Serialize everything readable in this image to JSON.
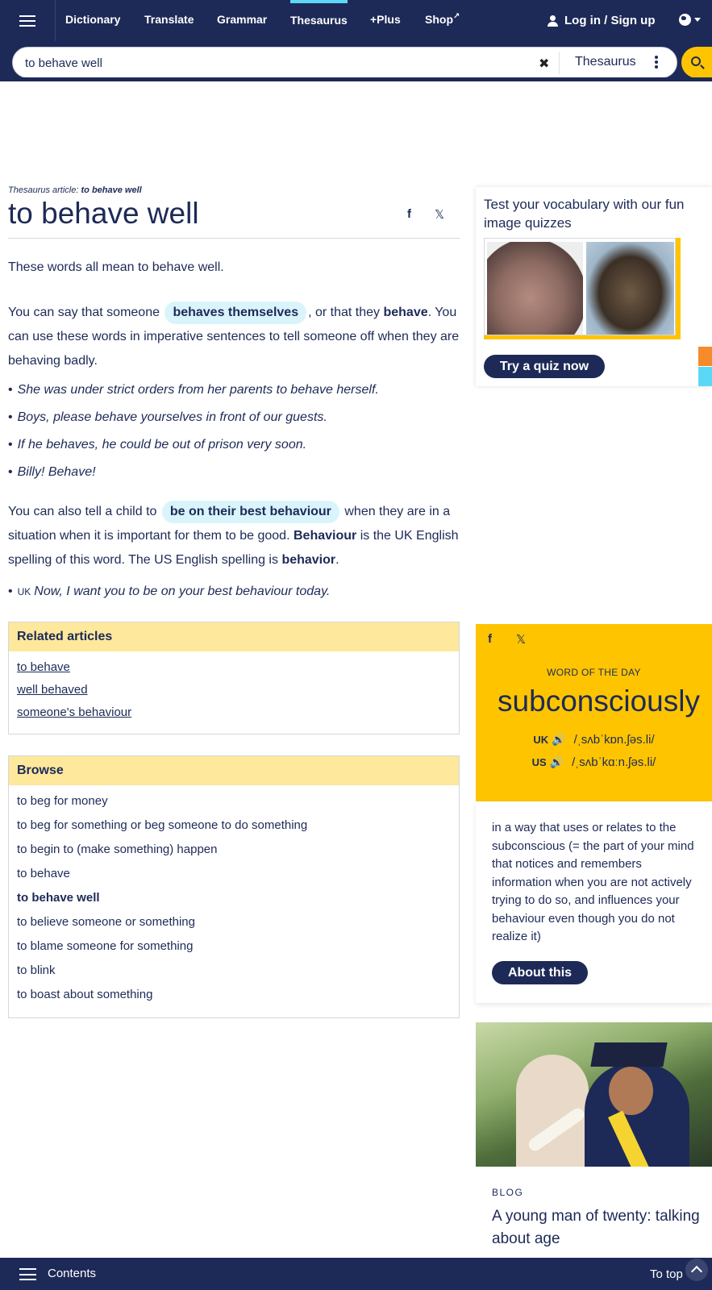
{
  "nav": {
    "items": [
      "Dictionary",
      "Translate",
      "Grammar",
      "Thesaurus",
      "+Plus",
      "Shop"
    ],
    "active": "Thesaurus",
    "login_label": "Log in / Sign up"
  },
  "search": {
    "value": "to behave well",
    "dictionary": "Thesaurus"
  },
  "article": {
    "crumb_prefix": "Thesaurus article:",
    "crumb_title": "to behave well",
    "headword": "to behave well",
    "intro": "These words all mean to behave well.",
    "para1": {
      "t1": "You can say that someone",
      "pill": "behaves themselves",
      "t2": ", or that they",
      "bold": "behave",
      "t3": ". You can use these words in imperative sentences to tell someone off when they are behaving badly."
    },
    "examples1": [
      "She was under strict orders from her parents to behave herself.",
      "Boys, please behave yourselves in front of our guests.",
      "If he behaves, he could be out of prison very soon.",
      "Billy! Behave!"
    ],
    "para2": {
      "t1": "You can also tell a child to",
      "pill": "be on their best behaviour",
      "t2": "when they are in a situation when it is important for them to be good.",
      "bold1": "Behaviour",
      "t3": "is the UK English spelling of this word. The US English spelling is",
      "bold2": "behavior",
      "t4": "."
    },
    "example2": {
      "label": "UK",
      "text": "Now, I want you to be on your best behaviour today."
    }
  },
  "related": {
    "heading": "Related articles",
    "links": [
      "to behave",
      "well behaved",
      "someone's behaviour"
    ]
  },
  "browse": {
    "heading": "Browse",
    "items": [
      "to beg for money",
      "to beg for something or beg someone to do something",
      "to begin to (make something) happen",
      "to behave",
      "to behave well",
      "to believe someone or something",
      "to blame someone for something",
      "to blink",
      "to boast about something"
    ],
    "current_index": 4
  },
  "quiz": {
    "title": "Test your vocabulary with our fun image quizzes",
    "button": "Try a quiz now"
  },
  "wotd": {
    "label": "WORD OF THE DAY",
    "word": "subconsciously",
    "uk_label": "UK",
    "uk_pron": "/ˌsʌbˈkɒn.ʃəs.li/",
    "us_label": "US",
    "us_pron": "/ˌsʌbˈkɑːn.ʃəs.li/",
    "definition": "in a way that uses or relates to the subconscious (= the part of your mind that notices and remembers information when you are not actively trying to do so, and influences your behaviour even though you do not realize it)",
    "button": "About this"
  },
  "blog": {
    "tag": "BLOG",
    "title": "A young man of twenty: talking about age"
  },
  "bottom": {
    "contents": "Contents",
    "to_top": "To top"
  },
  "colors": {
    "navy": "#1d2a57",
    "yellow": "#fec400",
    "cyan": "#5cd8f7",
    "pill": "#d9f4fb",
    "box_head": "#fde89c"
  }
}
